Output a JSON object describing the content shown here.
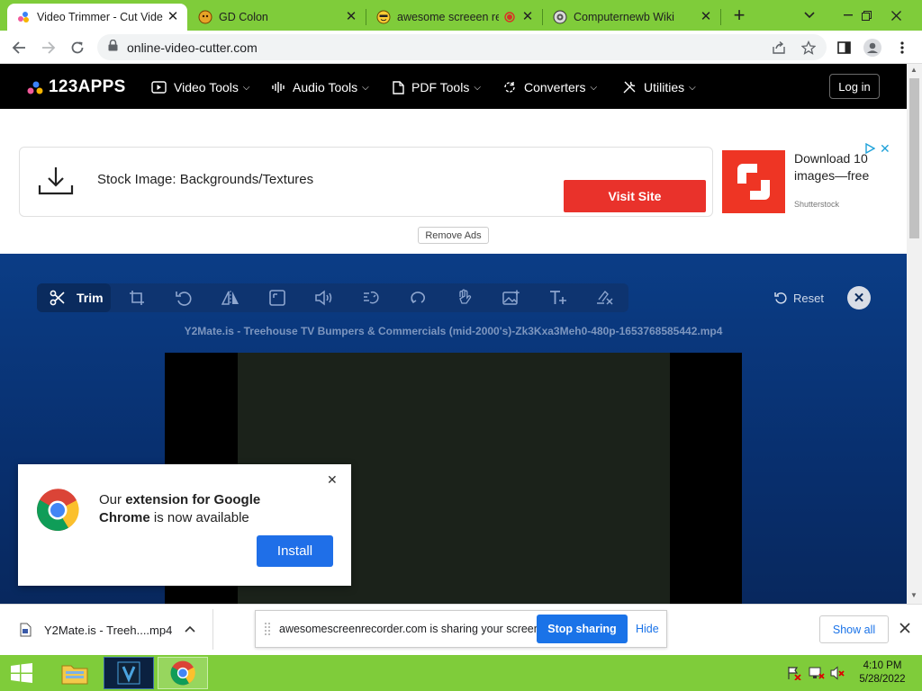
{
  "browser": {
    "tabs": [
      {
        "title": "Video Trimmer - Cut Vide",
        "active": true
      },
      {
        "title": "GD Colon",
        "active": false
      },
      {
        "title": "awesome screeen re",
        "active": false
      },
      {
        "title": "Computernewb Wiki",
        "active": false
      }
    ],
    "new_tab": "+",
    "url": "online-video-cutter.com"
  },
  "site": {
    "logo": "123APPS",
    "nav": [
      "Video Tools",
      "Audio Tools",
      "PDF Tools",
      "Converters",
      "Utilities"
    ],
    "login": "Log in"
  },
  "ad": {
    "text": "Stock Image: Backgrounds/Textures",
    "cta": "Visit Site",
    "side_text": "Download 10 images—free",
    "side_brand": "Shutterstock",
    "remove_ads": "Remove Ads"
  },
  "editor": {
    "trim_label": "Trim",
    "reset_label": "Reset",
    "filename": "Y2Mate.is - Treehouse TV Bumpers & Commercials (mid-2000's)-Zk3Kxa3Meh0-480p-1653768585442.mp4"
  },
  "popup": {
    "text_pre": "Our ",
    "text_bold1": "extension for Google",
    "text_bold2": "Chrome",
    "text_post": " is now available",
    "install": "Install"
  },
  "downloads": {
    "file": "Y2Mate.is - Treeh....mp4",
    "share_text": "awesomescreenrecorder.com is sharing your screen.",
    "stop_sharing": "Stop sharing",
    "hide": "Hide",
    "show_all": "Show all"
  },
  "taskbar": {
    "time": "4:10 PM",
    "date": "5/28/2022"
  }
}
